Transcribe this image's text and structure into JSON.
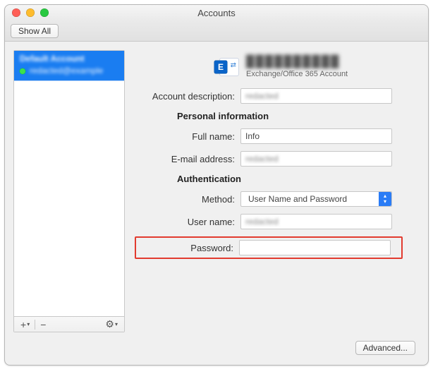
{
  "window": {
    "title": "Accounts"
  },
  "toolbar": {
    "show_all": "Show All"
  },
  "sidebar": {
    "account": {
      "title": "Default Account",
      "subtitle": "redacted@example"
    },
    "footer": {
      "add": "+",
      "remove": "−",
      "menu": "⚙"
    }
  },
  "detail": {
    "header": {
      "title": "██████████",
      "subtitle": "Exchange/Office 365 Account"
    },
    "labels": {
      "account_description": "Account description:",
      "personal_info": "Personal information",
      "full_name": "Full name:",
      "email": "E-mail address:",
      "authentication": "Authentication",
      "method": "Method:",
      "user_name": "User name:",
      "password": "Password:"
    },
    "values": {
      "account_description": "redacted",
      "full_name": "Info",
      "email": "redacted",
      "method": "User Name and Password",
      "user_name": "redacted",
      "password": ""
    },
    "advanced": "Advanced..."
  }
}
